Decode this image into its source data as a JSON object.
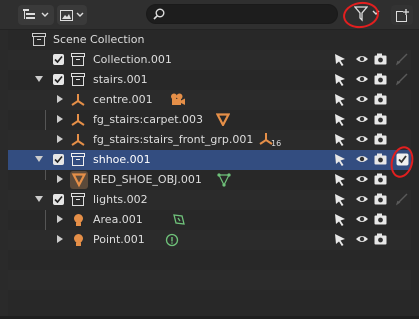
{
  "header": {
    "search_placeholder": "",
    "display_mode_icon": "outliner-icon",
    "filter_view_icon": "image-icon",
    "filter_icon": "funnel-icon",
    "new_collection_icon": "new-collection-icon"
  },
  "tree": {
    "scene_collection": "Scene Collection",
    "rows": [
      {
        "label": "Collection.001"
      },
      {
        "label": "stairs.001"
      },
      {
        "label": "centre.001"
      },
      {
        "label": "fg_stairs:carpet.003"
      },
      {
        "label": "fg_stairs:stairs_front_grp.001"
      },
      {
        "label": "shhoe.001"
      },
      {
        "label": "RED_SHOE_OBJ.001"
      },
      {
        "label": "lights.002"
      },
      {
        "label": "Area.001"
      },
      {
        "label": "Point.001"
      }
    ],
    "badge_16": "16"
  },
  "colors": {
    "selected_row": "#334d80",
    "object_orange": "#e58f48",
    "mesh_green": "#6fc27a",
    "annotation_red": "#e21f1f"
  }
}
